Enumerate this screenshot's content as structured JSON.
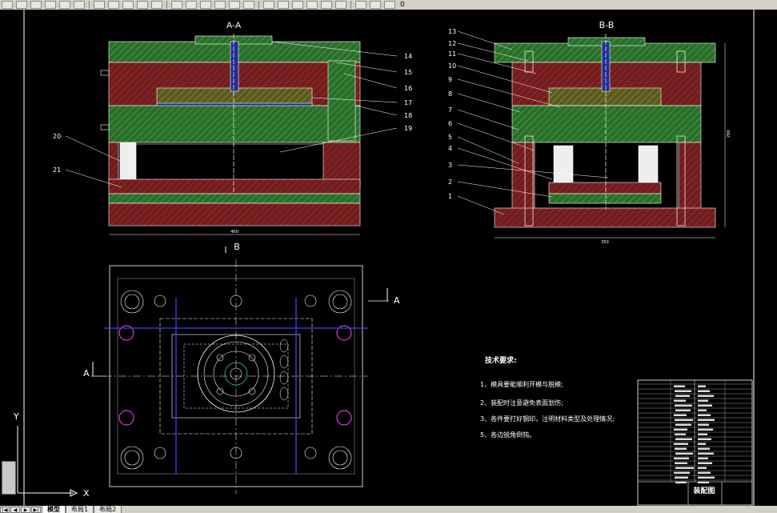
{
  "toolbar": {
    "icons": [
      "new-icon",
      "open-icon",
      "save-icon",
      "print-icon",
      "preview-icon",
      "publish-icon",
      "cut-icon",
      "copy-icon",
      "paste-icon",
      "match-icon",
      "undo-icon",
      "redo-icon",
      "hyperlink-icon",
      "pan-icon",
      "zoom-realtime-icon",
      "zoom-window-icon",
      "zoom-previous-icon",
      "properties-icon",
      "design-center-icon",
      "tool-palette-icon",
      "sheet-set-icon",
      "markup-icon",
      "calc-icon",
      "help-icon",
      "layer-icon",
      "layer-state-icon"
    ],
    "layer_value": "0"
  },
  "drawing": {
    "section_aa": "A-A",
    "section_bb": "B-B",
    "view_b_marker": "B",
    "view_a_marker_left": "A",
    "view_a_marker_right": "A",
    "dim_width_aa": "400",
    "dim_width_bb": "350",
    "dim_height_bb": "290",
    "part_numbers_left": [
      "20",
      "21"
    ],
    "part_numbers_right_aa": [
      "14",
      "15",
      "16",
      "17",
      "18",
      "19"
    ],
    "part_numbers_bb": [
      "13",
      "12",
      "11",
      "10",
      "9",
      "8",
      "7",
      "6",
      "5",
      "4",
      "3",
      "2",
      "1"
    ],
    "tech_title": "技术要求:",
    "tech_requirements": [
      "1、模具要能顺利开模与脱模;",
      "2、装配时注意避免表面划伤;",
      "3、各件要打好钢印，注明材料类型及处理情况;",
      "5、各边锐角倒钝。"
    ],
    "title_block_name": "装配图",
    "ucs_x": "X",
    "ucs_y": "Y"
  },
  "tabs": {
    "nav": [
      "|◀",
      "◀",
      "▶",
      "▶|"
    ],
    "items": [
      "模型",
      "布局1",
      "布局2"
    ]
  },
  "colors": {
    "background": "#000000",
    "green_plate": "#2a6e2a",
    "red_plate": "#6e1e1e",
    "blue_plate": "#1e2a8c",
    "line_white": "#ffffff",
    "line_yellow": "#e6e600",
    "line_magenta": "#d040d0",
    "line_blue": "#4040ff"
  }
}
